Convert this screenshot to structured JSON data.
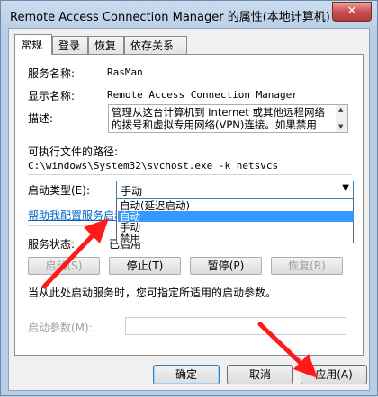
{
  "window": {
    "title": "Remote Access Connection Manager 的属性(本地计算机)",
    "close_glyph": "✕"
  },
  "tabs": [
    {
      "label": "常规"
    },
    {
      "label": "登录"
    },
    {
      "label": "恢复"
    },
    {
      "label": "依存关系"
    }
  ],
  "general": {
    "service_name_label": "服务名称:",
    "service_name_value": "RasMan",
    "display_name_label": "显示名称:",
    "display_name_value": "Remote Access Connection Manager",
    "description_label": "描述:",
    "description_value": "管理从这台计算机到 Internet 或其他远程网络的拨号和虚拟专用网络(VPN)连接。如果禁用",
    "exec_path_label": "可执行文件的路径:",
    "exec_path_value": "C:\\windows\\System32\\svchost.exe -k netsvcs",
    "startup_type_label": "启动类型(E):",
    "startup_type_value": "手动",
    "startup_options": [
      "自动(延迟启动)",
      "自动",
      "手动",
      "禁用"
    ],
    "startup_selected_index": 1,
    "help_link": "帮助我配置服务启动",
    "service_status_label": "服务状态:",
    "service_status_value": "已启用",
    "btn_start": "启动(S)",
    "btn_stop": "停止(T)",
    "btn_pause": "暂停(P)",
    "btn_resume": "恢复(R)",
    "hint": "当从此处启动服务时，您可指定所适用的启动参数。",
    "start_params_label": "启动参数(M):",
    "start_params_value": ""
  },
  "footer": {
    "ok": "确定",
    "cancel": "取消",
    "apply": "应用(A)"
  },
  "colors": {
    "accent": "#3399ff",
    "link": "#0066cc",
    "annotation_arrow": "#ff1a1a"
  }
}
